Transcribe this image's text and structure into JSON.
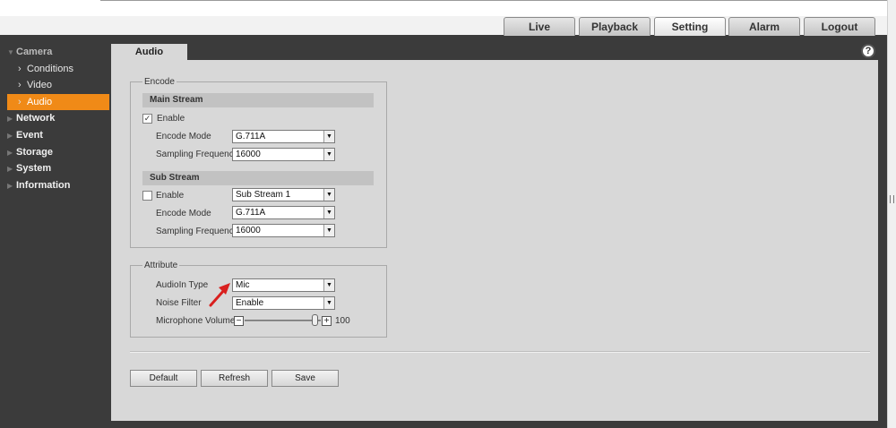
{
  "nav": {
    "tabs": [
      {
        "label": "Live"
      },
      {
        "label": "Playback"
      },
      {
        "label": "Setting"
      },
      {
        "label": "Alarm"
      },
      {
        "label": "Logout"
      }
    ],
    "active_tab": "Setting"
  },
  "sidebar": {
    "camera": "Camera",
    "sub_items": [
      {
        "label": "Conditions"
      },
      {
        "label": "Video"
      },
      {
        "label": "Audio"
      }
    ],
    "active_sub": "Audio",
    "items": [
      {
        "label": "Network"
      },
      {
        "label": "Event"
      },
      {
        "label": "Storage"
      },
      {
        "label": "System"
      },
      {
        "label": "Information"
      }
    ]
  },
  "content": {
    "tab": "Audio",
    "help_icon": "?",
    "encode": {
      "legend": "Encode",
      "main_stream": {
        "title": "Main Stream",
        "enable_label": "Enable",
        "enable_checked": true,
        "encode_mode_label": "Encode Mode",
        "encode_mode": "G.711A",
        "sampling_label": "Sampling Frequency",
        "sampling": "16000"
      },
      "sub_stream": {
        "title": "Sub Stream",
        "enable_label": "Enable",
        "enable_checked": false,
        "stream_select": "Sub Stream 1",
        "encode_mode_label": "Encode Mode",
        "encode_mode": "G.711A",
        "sampling_label": "Sampling Frequency",
        "sampling": "16000"
      }
    },
    "attribute": {
      "legend": "Attribute",
      "audioin_label": "AudioIn Type",
      "audioin": "Mic",
      "noise_label": "Noise Filter",
      "noise": "Enable",
      "volume_label": "Microphone Volume",
      "volume_value": "100",
      "volume_max": 100
    },
    "buttons": {
      "default": "Default",
      "refresh": "Refresh",
      "save": "Save"
    }
  },
  "colors": {
    "accent": "#f08a17",
    "frame": "#3b3b3b",
    "panel": "#d8d8d8",
    "arrow": "#d9201f"
  },
  "icons": {
    "dropdown": "triangle-down",
    "arrow_annotation": "red-arrow"
  }
}
